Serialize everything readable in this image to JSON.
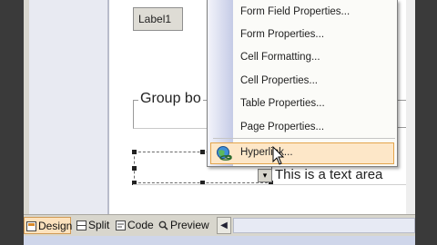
{
  "designer": {
    "label1": "Label1",
    "group_box_label": "Group bo",
    "text_area_label": "This is a text area",
    "dropdown_arrow": "▾"
  },
  "context_menu": {
    "items": [
      {
        "label": "Form Field Properties...",
        "icon": ""
      },
      {
        "label": "Form Properties...",
        "icon": ""
      },
      {
        "label": "Cell Formatting...",
        "icon": ""
      },
      {
        "label": "Cell Properties...",
        "icon": ""
      },
      {
        "label": "Table Properties...",
        "icon": ""
      },
      {
        "label": "Page Properties...",
        "icon": ""
      }
    ],
    "hyperlink": {
      "label": "Hyperlink...",
      "icon": "globe-link-icon"
    }
  },
  "view_tabs": {
    "design": "Design",
    "split": "Split",
    "code": "Code",
    "preview": "Preview"
  },
  "scroll_left_glyph": "◀",
  "status_text": "",
  "colors": {
    "menu_highlight": "#fde7c8",
    "menu_highlight_border": "#e4a54c",
    "active_tab": "#fde2bd",
    "chrome": "#d8d6cd"
  }
}
